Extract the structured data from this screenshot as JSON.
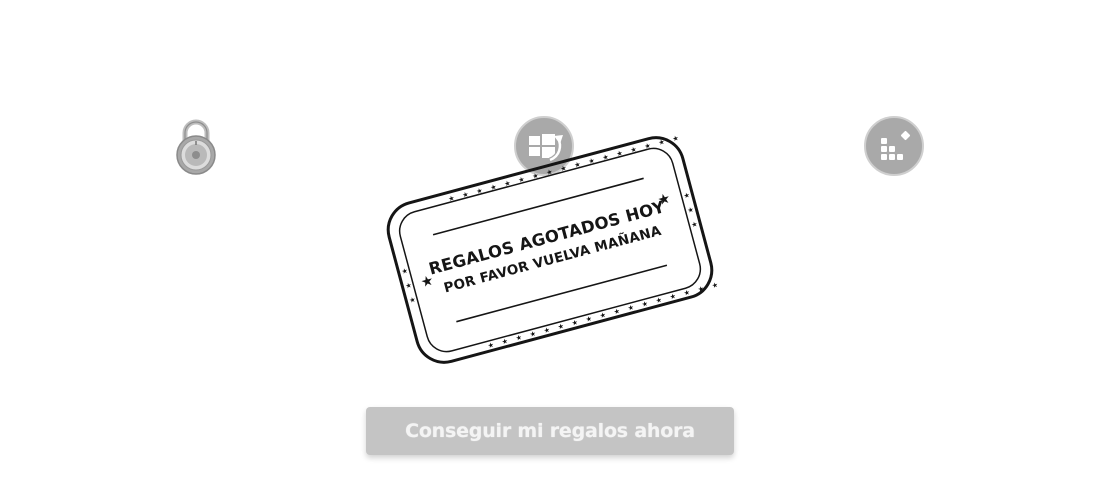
{
  "icons": {
    "left": "lock-icon",
    "center": "windows-upgrade-icon",
    "right": "blocks-icon"
  },
  "stamp": {
    "line1": "REGALOS AGOTADOS HOY",
    "line2": "POR FAVOR VUELVA MAÑANA"
  },
  "button": {
    "label": "Conseguir mi regalos ahora"
  },
  "colors": {
    "icon_gray": "#a9a9a9",
    "button_bg": "#c4c4c4",
    "stamp_ink": "#151515"
  }
}
